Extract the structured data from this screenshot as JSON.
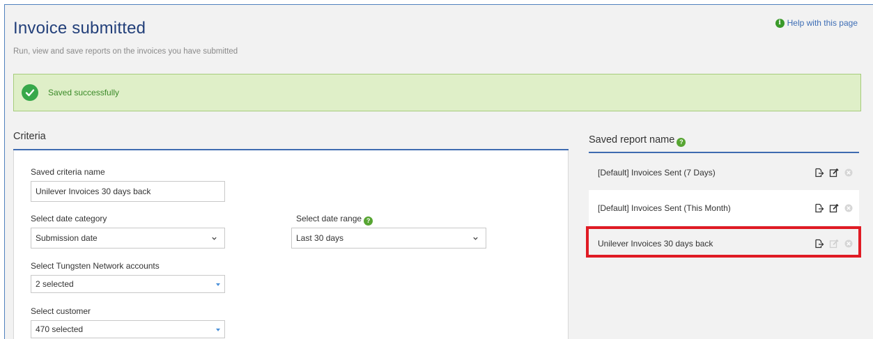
{
  "header": {
    "title": "Invoice submitted",
    "subtitle": "Run, view and save reports on the invoices you have submitted",
    "help_link": "Help with this page",
    "help_icon_glyph": "i"
  },
  "alert": {
    "text": "Saved successfully",
    "color": "#37a84a"
  },
  "criteria": {
    "heading": "Criteria",
    "saved_name_label": "Saved criteria name",
    "saved_name_value": "Unilever Invoices 30 days back",
    "date_category_label": "Select date category",
    "date_category_value": "Submission date",
    "date_range_label": "Select date range",
    "date_range_value": "Last 30 days",
    "accounts_label": "Select Tungsten Network accounts",
    "accounts_value": "2 selected",
    "customer_label": "Select customer",
    "customer_value": "470 selected"
  },
  "saved_reports": {
    "heading": "Saved report name",
    "items": [
      {
        "label": "[Default] Invoices Sent (7 Days)"
      },
      {
        "label": "[Default] Invoices Sent (This Month)"
      },
      {
        "label": "Unilever Invoices 30 days back"
      }
    ]
  },
  "colors": {
    "accent": "#3e6bb0",
    "title": "#23407a",
    "success_bg": "#dfefc8",
    "highlight": "#e01b24"
  }
}
